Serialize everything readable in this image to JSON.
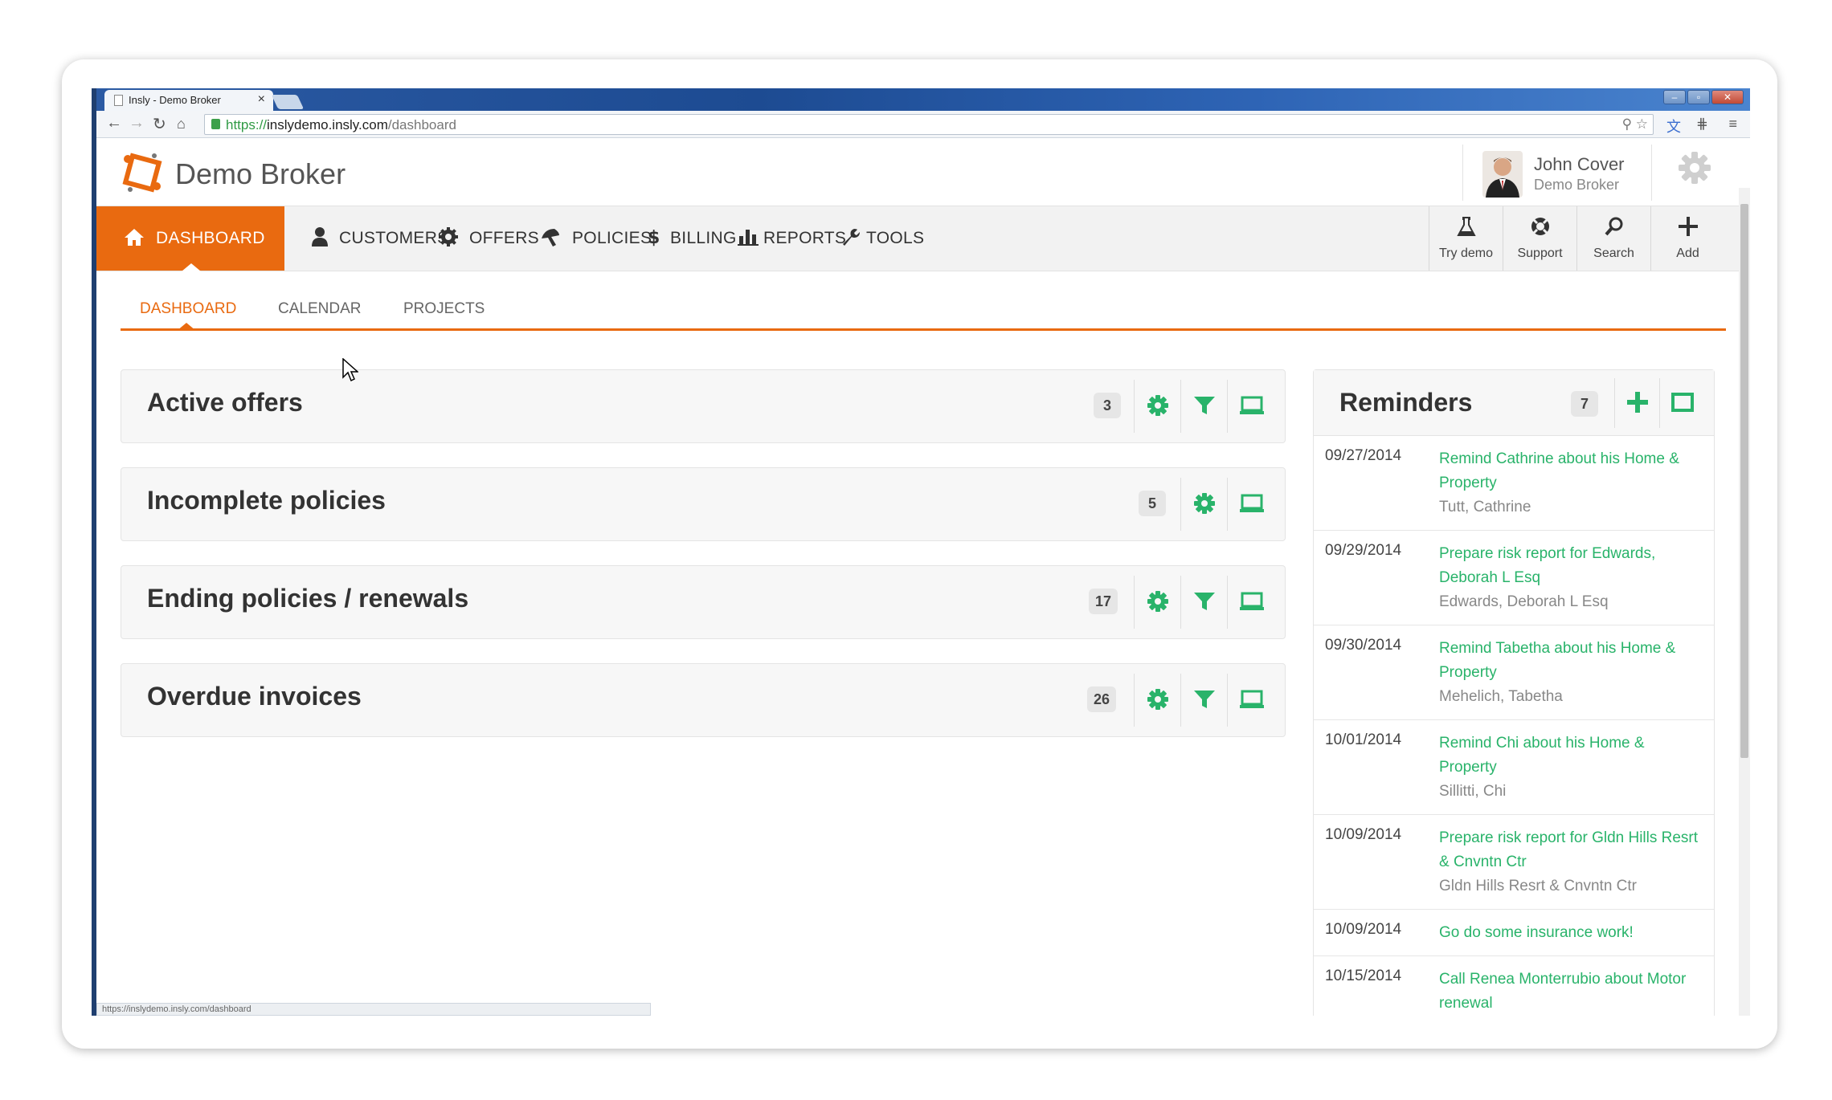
{
  "browser": {
    "tab_title": "Insly - Demo Broker",
    "tab_close": "×",
    "url_scheme": "https://",
    "url_host": "inslydemo.insly.com",
    "url_path": "/dashboard",
    "status_url": "https://inslydemo.insly.com/dashboard"
  },
  "header": {
    "brand": "Demo Broker",
    "user_name": "John Cover",
    "user_org": "Demo Broker"
  },
  "mainnav": {
    "items": [
      {
        "label": "DASHBOARD",
        "icon": "home-icon",
        "active": true
      },
      {
        "label": "CUSTOMERS",
        "icon": "user-icon"
      },
      {
        "label": "OFFERS",
        "icon": "gear-badge-icon"
      },
      {
        "label": "POLICIES",
        "icon": "umbrella-icon"
      },
      {
        "label": "BILLING",
        "icon": "dollar-icon"
      },
      {
        "label": "REPORTS",
        "icon": "bar-chart-icon"
      },
      {
        "label": "TOOLS",
        "icon": "wrench-icon"
      }
    ],
    "tools": [
      {
        "label": "Try demo",
        "icon": "flask-icon"
      },
      {
        "label": "Support",
        "icon": "lifebuoy-icon"
      },
      {
        "label": "Search",
        "icon": "search-icon"
      },
      {
        "label": "Add",
        "icon": "plus-icon"
      }
    ]
  },
  "subnav": {
    "items": [
      {
        "label": "DASHBOARD",
        "active": true
      },
      {
        "label": "CALENDAR"
      },
      {
        "label": "PROJECTS"
      }
    ]
  },
  "widgets": [
    {
      "title": "Active offers",
      "count": "3",
      "has_filter": true
    },
    {
      "title": "Incomplete policies",
      "count": "5",
      "has_filter": false
    },
    {
      "title": "Ending policies / renewals",
      "count": "17",
      "has_filter": true
    },
    {
      "title": "Overdue invoices",
      "count": "26",
      "has_filter": true
    }
  ],
  "reminders": {
    "title": "Reminders",
    "count": "7",
    "items": [
      {
        "date": "09/27/2014",
        "text": "Remind Cathrine about his Home & Property",
        "sub": "Tutt, Cathrine"
      },
      {
        "date": "09/29/2014",
        "text": "Prepare risk report for Edwards, Deborah L Esq",
        "sub": "Edwards, Deborah L Esq"
      },
      {
        "date": "09/30/2014",
        "text": "Remind Tabetha about his Home & Property",
        "sub": "Mehelich, Tabetha"
      },
      {
        "date": "10/01/2014",
        "text": "Remind Chi about his Home & Property",
        "sub": "Sillitti, Chi"
      },
      {
        "date": "10/09/2014",
        "text": "Prepare risk report for Gldn Hills Resrt & Cnvntn Ctr",
        "sub": "Gldn Hills Resrt & Cnvntn Ctr"
      },
      {
        "date": "10/09/2014",
        "text": "Go do some insurance work!",
        "sub": ""
      },
      {
        "date": "10/15/2014",
        "text": "Call Renea Monterrubio about Motor renewal",
        "sub": ""
      }
    ]
  },
  "colors": {
    "accent": "#e96a10",
    "green": "#29b36a",
    "nav_bg": "#f2f2f2"
  }
}
